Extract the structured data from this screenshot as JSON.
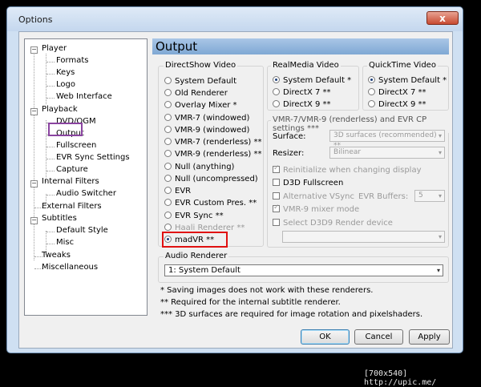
{
  "window": {
    "title": "Options",
    "close_glyph": "x"
  },
  "tree": {
    "items": [
      {
        "label": "Player",
        "expander": "−"
      },
      {
        "label": "Formats"
      },
      {
        "label": "Keys"
      },
      {
        "label": "Logo"
      },
      {
        "label": "Web Interface"
      },
      {
        "label": "Playback",
        "expander": "−"
      },
      {
        "label": "DVD/OGM"
      },
      {
        "label": "Output"
      },
      {
        "label": "Fullscreen"
      },
      {
        "label": "EVR Sync Settings"
      },
      {
        "label": "Capture"
      },
      {
        "label": "Internal Filters",
        "expander": "−"
      },
      {
        "label": "Audio Switcher"
      },
      {
        "label": "External Filters"
      },
      {
        "label": "Subtitles",
        "expander": "−"
      },
      {
        "label": "Default Style"
      },
      {
        "label": "Misc"
      },
      {
        "label": "Tweaks"
      },
      {
        "label": "Miscellaneous"
      }
    ]
  },
  "header": {
    "title": "Output"
  },
  "directshow": {
    "label": "DirectShow Video",
    "options": [
      {
        "label": "System Default",
        "selected": false
      },
      {
        "label": "Old Renderer",
        "selected": false
      },
      {
        "label": "Overlay Mixer *",
        "selected": false
      },
      {
        "label": "VMR-7 (windowed)",
        "selected": false
      },
      {
        "label": "VMR-9 (windowed)",
        "selected": false
      },
      {
        "label": "VMR-7 (renderless) **",
        "selected": false
      },
      {
        "label": "VMR-9 (renderless) **",
        "selected": false
      },
      {
        "label": "Null (anything)",
        "selected": false
      },
      {
        "label": "Null (uncompressed)",
        "selected": false
      },
      {
        "label": "EVR",
        "selected": false
      },
      {
        "label": "EVR Custom Pres. **",
        "selected": false
      },
      {
        "label": "EVR Sync **",
        "selected": false
      },
      {
        "label": "Haali Renderer **",
        "selected": false,
        "disabled": true
      },
      {
        "label": "madVR **",
        "selected": true
      }
    ]
  },
  "realmedia": {
    "label": "RealMedia Video",
    "options": [
      {
        "label": "System Default *",
        "selected": true
      },
      {
        "label": "DirectX 7 **",
        "selected": false
      },
      {
        "label": "DirectX 9 **",
        "selected": false
      }
    ]
  },
  "quicktime": {
    "label": "QuickTime Video",
    "options": [
      {
        "label": "System Default *",
        "selected": true
      },
      {
        "label": "DirectX 7 **",
        "selected": false
      },
      {
        "label": "DirectX 9 **",
        "selected": false
      }
    ]
  },
  "vmr": {
    "label": "VMR-7/VMR-9 (renderless) and EVR CP settings ***",
    "surface_label": "Surface:",
    "surface_value": "3D surfaces (recommended) **",
    "resizer_label": "Resizer:",
    "resizer_value": "Bilinear",
    "reinit_label": "Reinitialize when changing display",
    "d3d_label": "D3D Fullscreen",
    "altvsync_label": "Alternative VSync",
    "evrbuffers_label": "EVR Buffers:",
    "evrbuffers_value": "5",
    "mixer_label": "VMR-9 mixer mode",
    "selectd3d9_label": "Select D3D9 Render device",
    "device_value": ""
  },
  "audio": {
    "label": "Audio Renderer",
    "value": "1: System Default"
  },
  "notes": [
    "* Saving images does not work with these renderers.",
    "** Required for the internal subtitle renderer.",
    "*** 3D surfaces are required for image rotation and pixelshaders."
  ],
  "buttons": {
    "ok": "OK",
    "cancel": "Cancel",
    "apply": "Apply"
  },
  "watermark": "[700x540] http://upic.me/"
}
